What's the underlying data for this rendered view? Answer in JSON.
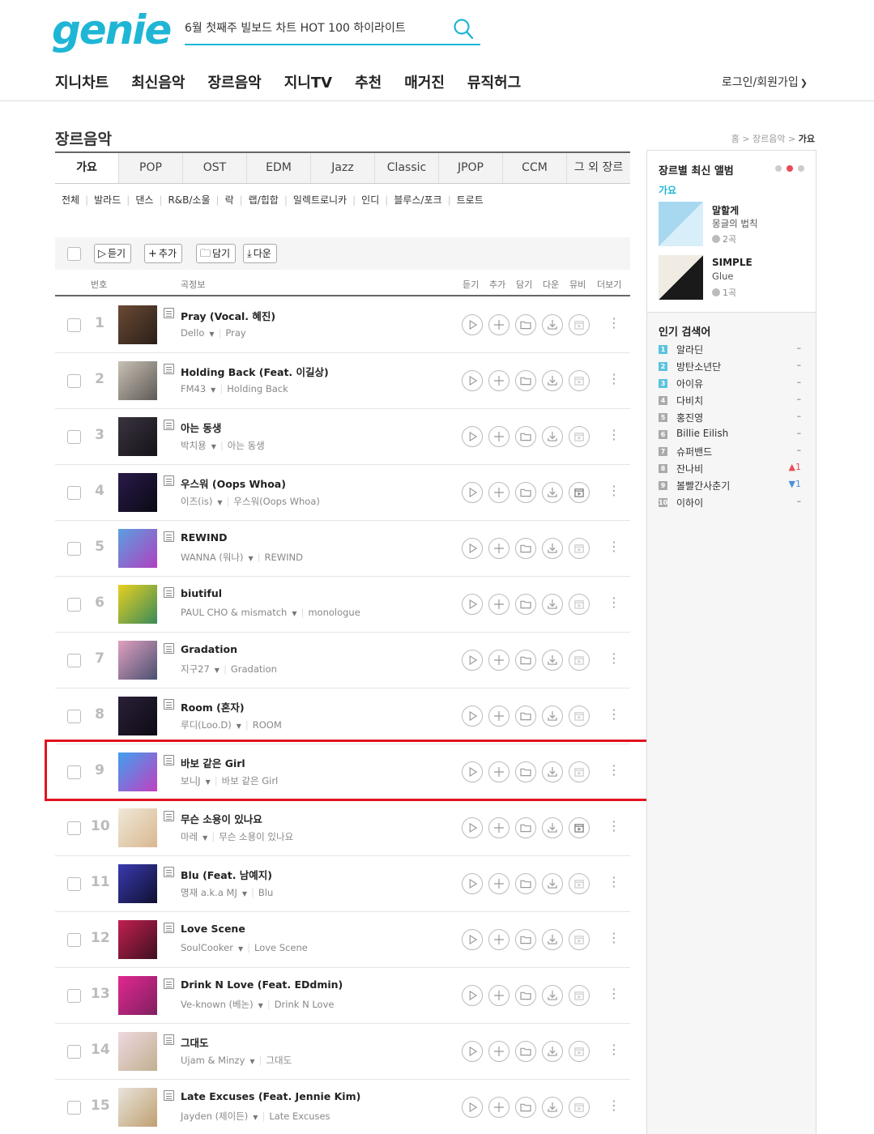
{
  "header": {
    "logo": "genie",
    "search_value": "6월 첫째주 빌보드 차트 HOT 100 하이라이트",
    "nav": [
      "지니차트",
      "최신음악",
      "장르음악",
      "지니TV",
      "추천",
      "매거진",
      "뮤직허그"
    ],
    "login": "로그인/회원가입"
  },
  "page": {
    "title": "장르음악",
    "breadcrumb": [
      "홈",
      "장르음악",
      "가요"
    ]
  },
  "genre_tabs": [
    "가요",
    "POP",
    "OST",
    "EDM",
    "Jazz",
    "Classic",
    "JPOP",
    "CCM",
    "그 외 장르"
  ],
  "subgenres": [
    "전체",
    "발라드",
    "댄스",
    "R&B/소울",
    "락",
    "랩/힙합",
    "일렉트로니카",
    "인디",
    "블루스/포크",
    "트로트"
  ],
  "actions": [
    "듣기",
    "추가",
    "담기",
    "다운"
  ],
  "columns": {
    "number": "번호",
    "info": "곡정보",
    "listen": "듣기",
    "add": "추가",
    "save": "담기",
    "down": "다운",
    "mv": "뮤비",
    "more": "더보기"
  },
  "tracks": [
    {
      "rank": "1",
      "title": "Pray (Vocal. 혜진)",
      "artist": "Dello",
      "album": "Pray",
      "cover": [
        "#6b4a35",
        "#2a1f18"
      ],
      "mv": false
    },
    {
      "rank": "2",
      "title": "Holding Back (Feat. 이길상)",
      "artist": "FM43",
      "album": "Holding Back",
      "cover": [
        "#c8c0b4",
        "#5e5a56"
      ],
      "mv": false
    },
    {
      "rank": "3",
      "title": "아는 동생",
      "artist": "박치용",
      "album": "아는 동생",
      "cover": [
        "#3a3440",
        "#151218"
      ],
      "mv": false
    },
    {
      "rank": "4",
      "title": "우스워 (Oops Whoa)",
      "artist": "이즈(is)",
      "album": "우스워(Oops Whoa)",
      "cover": [
        "#2a1a4a",
        "#0a0a14"
      ],
      "mv": true
    },
    {
      "rank": "5",
      "title": "REWIND",
      "artist": "WANNA (워나)",
      "album": "REWIND",
      "cover": [
        "#5aa0e0",
        "#b040c0"
      ],
      "mv": false
    },
    {
      "rank": "6",
      "title": "biutiful",
      "artist": "PAUL CHO & mismatch",
      "album": "monologue",
      "cover": [
        "#e8d020",
        "#3a8a5a"
      ],
      "mv": false
    },
    {
      "rank": "7",
      "title": "Gradation",
      "artist": "지구27",
      "album": "Gradation",
      "cover": [
        "#e0a0c0",
        "#4a5070"
      ],
      "mv": false
    },
    {
      "rank": "8",
      "title": "Room (혼자)",
      "artist": "루디(Loo.D)",
      "album": "ROOM",
      "cover": [
        "#2a2038",
        "#0e0a14"
      ],
      "mv": false
    },
    {
      "rank": "9",
      "title": "바보 같은 Girl",
      "artist": "보니J",
      "album": "바보 같은 Girl",
      "cover": [
        "#40a0f0",
        "#c040c0"
      ],
      "mv": false
    },
    {
      "rank": "10",
      "title": "무슨 소용이 있나요",
      "artist": "마레",
      "album": "무슨 소용이 있나요",
      "cover": [
        "#f0e8d8",
        "#d8b890"
      ],
      "mv": true
    },
    {
      "rank": "11",
      "title": "Blu (Feat. 남예지)",
      "artist": "명재 a.k.a MJ",
      "album": "Blu",
      "cover": [
        "#3a3ab0",
        "#101030"
      ],
      "mv": false
    },
    {
      "rank": "12",
      "title": "Love Scene",
      "artist": "SoulCooker",
      "album": "Love Scene",
      "cover": [
        "#c02050",
        "#401020"
      ],
      "mv": false
    },
    {
      "rank": "13",
      "title": "Drink N Love (Feat. EDdmin)",
      "artist": "Ve-known (베논)",
      "album": "Drink N Love",
      "cover": [
        "#e02890",
        "#802060"
      ],
      "mv": false
    },
    {
      "rank": "14",
      "title": "그대도",
      "artist": "Ujam & Minzy",
      "album": "그대도",
      "cover": [
        "#f0d8e0",
        "#c0b090"
      ],
      "mv": false
    },
    {
      "rank": "15",
      "title": "Late Excuses (Feat. Jennie Kim)",
      "artist": "Jayden (제이든)",
      "album": "Late Excuses",
      "cover": [
        "#e8e4dc",
        "#c0a070"
      ],
      "mv": false
    }
  ],
  "sidebar": {
    "latest_title": "장르별 최신 앨범",
    "latest_category": "가요",
    "albums": [
      {
        "name": "말할게",
        "artist": "몽글의 법칙",
        "count": "2곡",
        "cover": [
          "#a8d8f0",
          "#d8eef8"
        ]
      },
      {
        "name": "SIMPLE",
        "artist": "Glue",
        "count": "1곡",
        "cover": [
          "#f0ece4",
          "#1a1a1a"
        ]
      }
    ],
    "popular_title": "인기 검색어",
    "popular": [
      {
        "rank": "1",
        "name": "알라딘",
        "change": "–",
        "dir": "none"
      },
      {
        "rank": "2",
        "name": "방탄소년단",
        "change": "–",
        "dir": "none"
      },
      {
        "rank": "3",
        "name": "아이유",
        "change": "–",
        "dir": "none"
      },
      {
        "rank": "4",
        "name": "다비치",
        "change": "–",
        "dir": "none"
      },
      {
        "rank": "5",
        "name": "홍진영",
        "change": "–",
        "dir": "none"
      },
      {
        "rank": "6",
        "name": "Billie Eilish",
        "change": "–",
        "dir": "none"
      },
      {
        "rank": "7",
        "name": "슈퍼밴드",
        "change": "–",
        "dir": "none"
      },
      {
        "rank": "8",
        "name": "잔나비",
        "change": "▲1",
        "dir": "up"
      },
      {
        "rank": "9",
        "name": "볼빨간사춘기",
        "change": "▼1",
        "dir": "down"
      },
      {
        "rank": "10",
        "name": "이하이",
        "change": "–",
        "dir": "none"
      }
    ]
  },
  "colors": {
    "brand": "#1fb6d6",
    "highlight": "#e2131f"
  }
}
